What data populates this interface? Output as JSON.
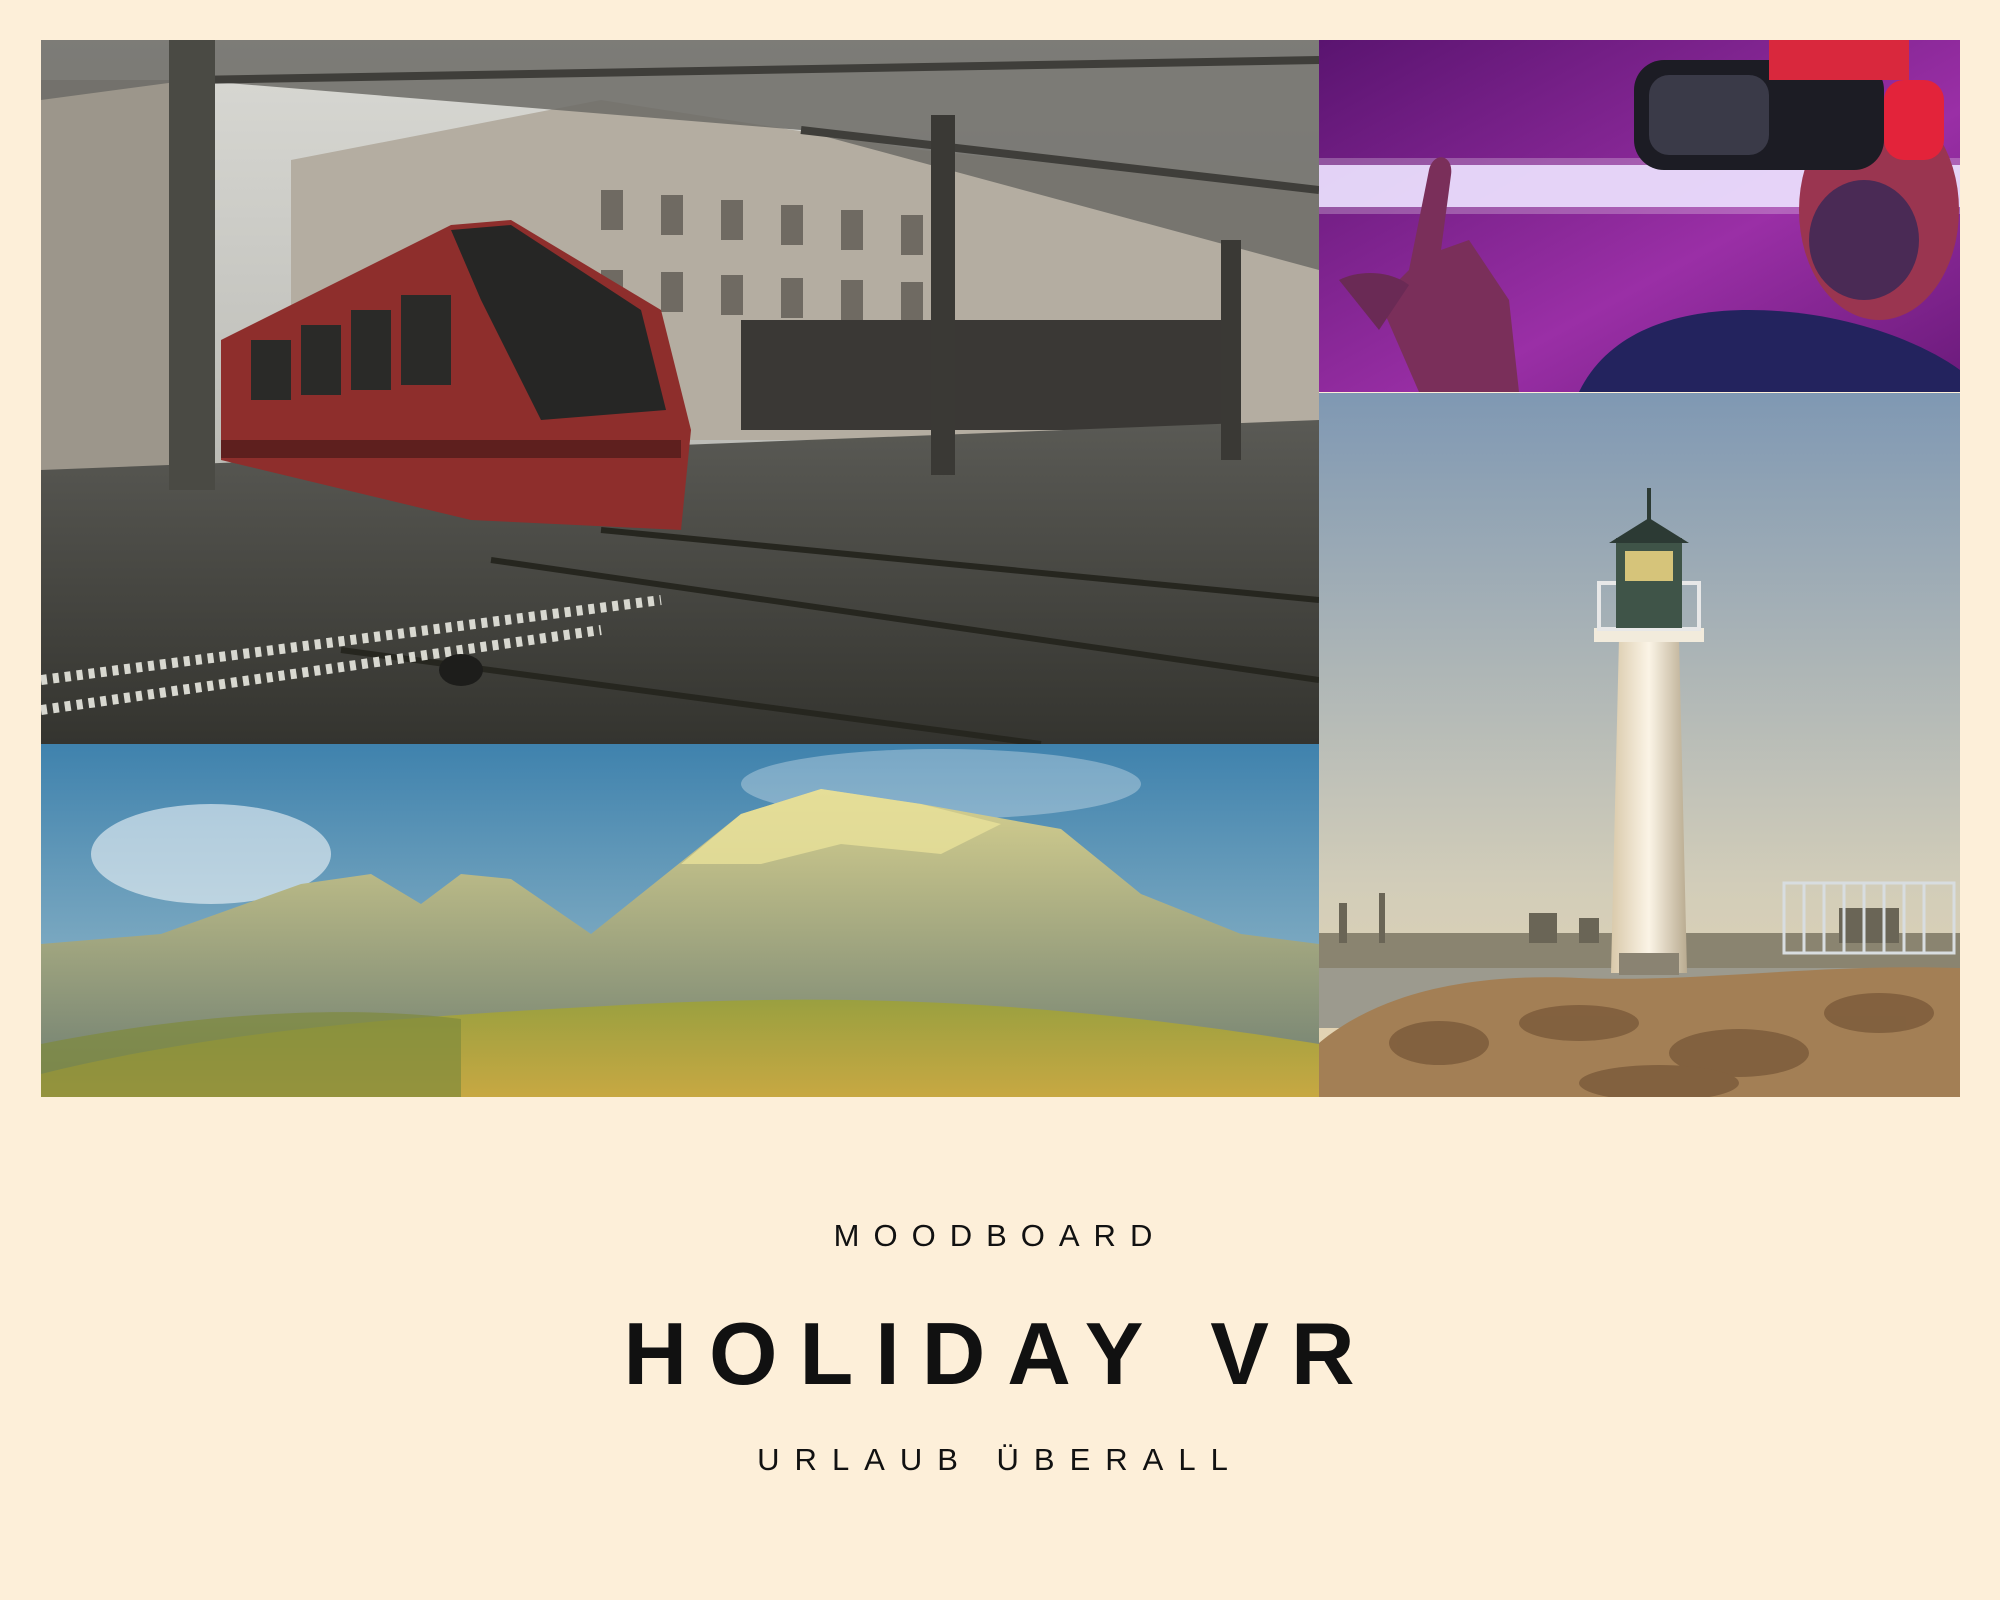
{
  "board": {
    "kicker": "MOODBOARD",
    "title": "HOLIDAY VR",
    "subtitle": "URLAUB ÜBERALL"
  },
  "photos": [
    {
      "name": "tram-photo",
      "subject": "abandoned red tram under station canopy"
    },
    {
      "name": "vr-headset-photo",
      "subject": "man wearing vr headset in neon light"
    },
    {
      "name": "mountain-photo",
      "subject": "rocky mountains over grassy hills"
    },
    {
      "name": "lighthouse-photo",
      "subject": "white lighthouse on rocky harbour pier"
    }
  ],
  "colors": {
    "background": "#fdefd9",
    "text": "#111111"
  }
}
